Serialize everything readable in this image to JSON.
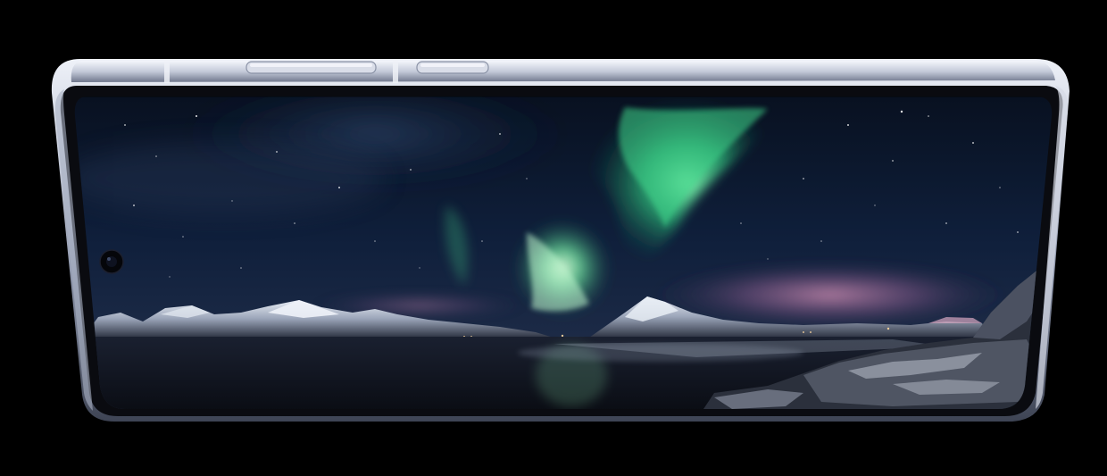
{
  "scene": {
    "subject": "smartphone-landscape",
    "wallpaper": "aurora-night-sky-over-mountains-and-rocky-shore",
    "colors": {
      "background": "#000000",
      "frame_light": "#dfe3ee",
      "frame_mid": "#a9b1c6",
      "frame_dark": "#5b6274",
      "bezel": "#0b0c10",
      "sky_top": "#070d1c",
      "sky_mid": "#0f1e3a",
      "sky_horizon": "#1d2c48",
      "aurora_green": "#3dd68c",
      "aurora_glow": "#9ff0b6",
      "pink_glow": "#d88bb5",
      "snow": "#cfd6e4",
      "mountain_dark": "#2a303f",
      "water": "#0c0f16",
      "rocks": "#3a3f4c"
    },
    "icons": {
      "front_camera": "camera-punch-hole-icon",
      "volume_button": "volume-rocker-icon",
      "power_button": "power-button-icon"
    }
  }
}
